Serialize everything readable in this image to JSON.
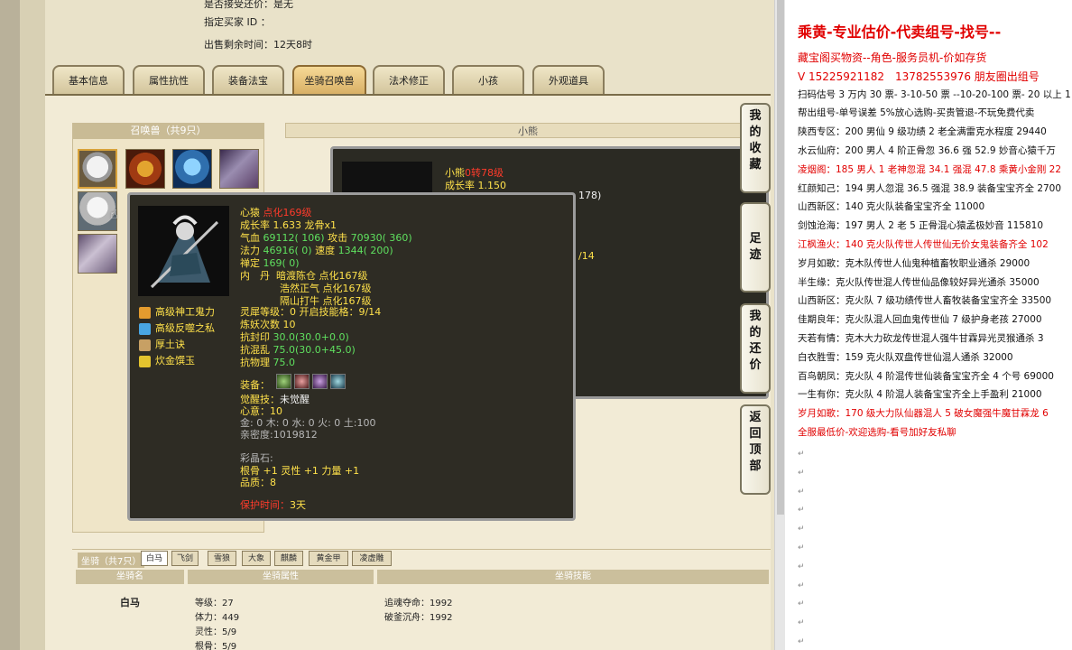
{
  "header": {
    "line1_label": "是否接受还价：",
    "line1_value": "是无",
    "buyer_label": "指定买家 ID ：",
    "time_label": "出售剩余时间：",
    "time_value": "12天8时"
  },
  "tabs": [
    "基本信息",
    "属性抗性",
    "装备法宝",
    "坐骑召唤兽",
    "法术修正",
    "小孩",
    "外观道具"
  ],
  "active_tab": "坐骑召唤兽",
  "summon_panel": {
    "title": "召唤兽（共9只）"
  },
  "xiao_panel": {
    "title": "小熊",
    "name": "小熊",
    "name_suffix": "0转78级",
    "growth": "成长率 1.150",
    "partial1": "178)",
    "partial2": "/14"
  },
  "popup": {
    "name": "心猿",
    "level": "点化169级",
    "growth": "成长率 1.633 龙骨x1",
    "hp_label": "气血",
    "hp": "69112( 106)",
    "atk_label": "攻击",
    "atk": "70930( 360)",
    "mp_label": "法力",
    "mp": "46916( 0)",
    "spd_label": "速度",
    "spd": "1344( 200)",
    "zen_label": "禅定",
    "zen": "169( 0)",
    "neidan_label": "内　丹",
    "neidan1": "暗渡陈仓 点化167级",
    "neidan2": "浩然正气 点化167级",
    "neidan3": "隔山打牛 点化167级",
    "lingxi_label": "灵犀等级：",
    "lingxi": "0 开启技能格：9/14",
    "lianyao": "炼妖次数 10",
    "r1_label": "抗封印",
    "r1": "30.0(30.0+0.0)",
    "r2_label": "抗混乱",
    "r2": "75.0(30.0+45.0)",
    "r3_label": "抗物理",
    "r3": "75.0",
    "equip_label": "装备：",
    "awaken_label": "觉醒技：",
    "awaken": "未觉醒",
    "heart_label": "心意：",
    "heart": "10",
    "elements": "金: 0 木: 0 水: 0 火: 0 土:100",
    "intimacy": "亲密度:1019812",
    "crystal_label": "彩晶石:",
    "crystal": "根骨 +1 灵性 +1 力量 +1",
    "quality": "品质：8",
    "protect_label": "保护时间：",
    "protect": "3天",
    "skills": [
      "高级神工鬼力",
      "高级反噬之私",
      "厚土诀",
      "炊金馔玉"
    ]
  },
  "side_buttons": [
    "我的收藏",
    "足迹",
    "我的还价",
    "返回顶部"
  ],
  "mount": {
    "title": "坐骑（共7只）",
    "tabs": [
      "白马",
      "飞剑",
      "雪狼",
      "大象",
      "麒麟",
      "黄金甲",
      "凌虚雕"
    ],
    "active": "白马",
    "col1": "坐骑名",
    "col2": "坐骑属性",
    "col3": "坐骑技能",
    "name": "白马",
    "attrs": [
      "等级：27",
      "体力：449",
      "灵性：5/9",
      "根骨：5/9"
    ],
    "skills": [
      "追魂夺命：1992",
      "破釜沉舟：1992"
    ]
  },
  "right_panel": {
    "heading": "乘黄-专业估价-代卖组号-找号--",
    "lines": [
      {
        "t": "藏宝阁买物资--角色-服务员机-价如存货",
        "red": true
      },
      {
        "t": "V 15225921182　13782553976 朋友圈出组号",
        "red": true
      },
      {
        "t": "扫码估号 3 万内 30 票- 3-10-50 票 --10-20-100 票- 20 以上 1",
        "red": false
      },
      {
        "t": "帮出组号-单号误差 5%放心选购-买贵管退-不玩免费代卖",
        "red": false
      },
      {
        "t": "陕西专区：200 男仙 9 级功绩 2 老全满雷克水程度 29440",
        "red": false
      },
      {
        "t": "水云仙府：200 男人 4 阶正骨忽 36.6 强 52.9 妙音心猿千万",
        "red": false
      },
      {
        "t": "凌烟阁：185 男人 1 老神忽混 34.1 强混 47.8 乘黄小金刚 22",
        "red": true
      },
      {
        "t": "红颜知己：194 男人忽混 36.5 强混 38.9 装备宝宝齐全 2700",
        "red": false
      },
      {
        "t": "山西新区：140 克火队装备宝宝齐全 11000",
        "red": false
      },
      {
        "t": "剑蚀沧海：197 男人 2 老 5 正骨混心猿孟极妙音 115810",
        "red": false
      },
      {
        "t": "江枫渔火：140 克火队传世人传世仙无价女鬼装备齐全 102",
        "red": true
      },
      {
        "t": "岁月如歌：克木队传世人仙鬼种植畜牧职业通杀 29000",
        "red": false
      },
      {
        "t": "半生缘：克火队传世混人传世仙品像较好异光通杀 35000",
        "red": false
      },
      {
        "t": "山西新区：克火队 7 级功绩传世人畜牧装备宝宝齐全 33500",
        "red": false
      },
      {
        "t": "佳期良年：克火队混人回血鬼传世仙 7 级护身老孩 27000",
        "red": false
      },
      {
        "t": "天若有情：克木大力砍龙传世混人强牛甘霖异光灵猴通杀 3",
        "red": false
      },
      {
        "t": "白衣胜雪：159 克火队双盘传世仙混人通杀 32000",
        "red": false
      },
      {
        "t": "百鸟朝凤：克火队 4 阶混传世仙装备宝宝齐全 4 个号 69000",
        "red": false
      },
      {
        "t": "一生有你：克火队 4 阶混人装备宝宝齐全上手盈利 21000",
        "red": false
      },
      {
        "t": "岁月如歌：170 级大力队仙器混人 5 破女魔强牛魔甘霖龙 6",
        "red": true
      },
      {
        "t": "全服最低价-欢迎选购-看号加好友私聊",
        "red": true
      }
    ]
  }
}
